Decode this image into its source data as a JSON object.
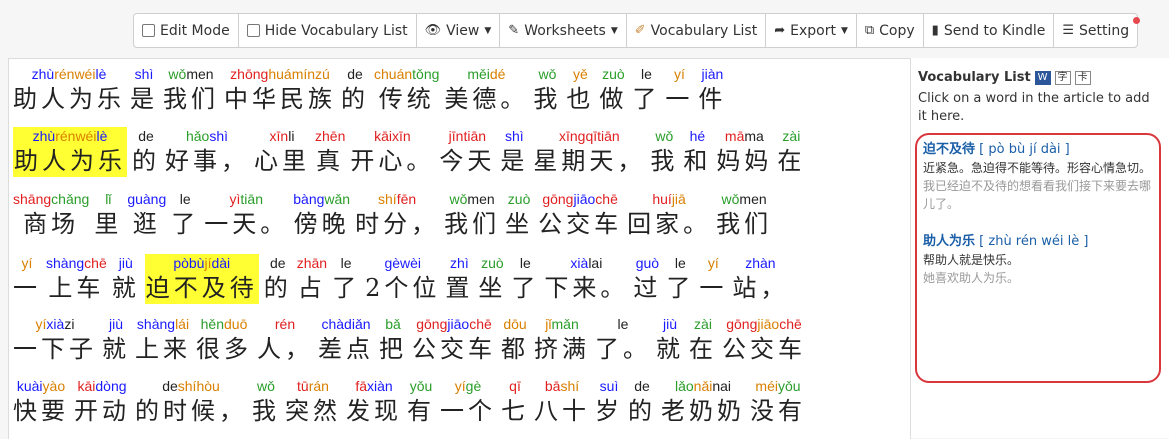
{
  "toolbar": {
    "edit_mode": "Edit Mode",
    "hide_vocab": "Hide Vocabulary List",
    "view": "View",
    "worksheets": "Worksheets",
    "vocab_list": "Vocabulary List",
    "export": "Export",
    "copy": "Copy",
    "send_kindle": "Send to Kindle",
    "setting": "Setting"
  },
  "colors": {
    "blue": "#1a1aff",
    "green": "#2a9d2a",
    "red": "#e02020",
    "orange": "#d98000",
    "highlight": "#ffff33",
    "circle": "#d9373e"
  },
  "article": [
    [
      [
        "zhù",
        "b",
        "rén",
        "o",
        "wéi",
        "o",
        "lè",
        "b",
        "助人为乐"
      ],
      [
        "shì",
        "b",
        "是"
      ],
      [
        "wǒ",
        "g",
        "men",
        "k",
        "我们"
      ],
      [
        "zhōng",
        "r",
        "huá",
        "o",
        "mín",
        "o",
        "zú",
        "o",
        "中华民族"
      ],
      [
        "de",
        "k",
        "的"
      ],
      [
        "chuán",
        "o",
        "tǒng",
        "g",
        "传统"
      ],
      [
        "měi",
        "g",
        "dé",
        "o",
        "美德。"
      ],
      [
        "wǒ",
        "g",
        "我"
      ],
      [
        "yě",
        "o",
        "也"
      ],
      [
        "zuò",
        "g",
        "做"
      ],
      [
        "le",
        "k",
        "了"
      ],
      [
        "yí",
        "o",
        "一"
      ],
      [
        "jiàn",
        "b",
        "件"
      ]
    ],
    [
      [
        "zhù",
        "b",
        "rén",
        "o",
        "wéi",
        "o",
        "lè",
        "b",
        "助人为乐",
        "hl"
      ],
      [
        "de",
        "k",
        "的"
      ],
      [
        "hǎo",
        "g",
        "shì",
        "b",
        "好事，"
      ],
      [
        "xīn",
        "r",
        "li",
        "k",
        "心里"
      ],
      [
        "zhēn",
        "r",
        "真"
      ],
      [
        "kāi",
        "r",
        "xīn",
        "r",
        "开心。"
      ],
      [
        "jīn",
        "r",
        "tiān",
        "r",
        "今天"
      ],
      [
        "shì",
        "b",
        "是"
      ],
      [
        "xīng",
        "r",
        "qī",
        "r",
        "tiān",
        "r",
        "星期天，"
      ],
      [
        "wǒ",
        "g",
        "我"
      ],
      [
        "hé",
        "b",
        "和"
      ],
      [
        "mā",
        "r",
        "ma",
        "k",
        "妈妈"
      ],
      [
        "zài",
        "g",
        "在"
      ]
    ],
    [
      [
        "shāng",
        "r",
        "chǎng",
        "g",
        "商场"
      ],
      [
        "lǐ",
        "g",
        "里"
      ],
      [
        "guàng",
        "b",
        "逛"
      ],
      [
        "le",
        "k",
        "了"
      ],
      [
        "yì",
        "r",
        "tiān",
        "g",
        "一天。"
      ],
      [
        "bàng",
        "b",
        "wǎn",
        "g",
        "傍晚"
      ],
      [
        "shí",
        "o",
        "fēn",
        "r",
        "时分，"
      ],
      [
        "wǒ",
        "g",
        "men",
        "k",
        "我们"
      ],
      [
        "zuò",
        "g",
        "坐"
      ],
      [
        "gōng",
        "r",
        "jiāo",
        "b",
        "chē",
        "r",
        "公交车"
      ],
      [
        "huí",
        "r",
        "jiā",
        "o",
        "回家。"
      ],
      [
        "wǒ",
        "g",
        "men",
        "k",
        "我们"
      ]
    ],
    [
      [
        "yí",
        "o",
        "一"
      ],
      [
        "shàng",
        "b",
        "chē",
        "r",
        "上车"
      ],
      [
        "jiù",
        "b",
        "就"
      ],
      [
        "pò",
        "b",
        "bù",
        "b",
        "jí",
        "o",
        "dài",
        "b",
        "迫不及待",
        "hl"
      ],
      [
        "de",
        "k",
        "的"
      ],
      [
        "zhān",
        "r",
        "占"
      ],
      [
        "le",
        "k",
        "了"
      ],
      [
        "gè",
        "b",
        "wèi",
        "b",
        "2个位"
      ],
      [
        "zhì",
        "b",
        "置"
      ],
      [
        "zuò",
        "g",
        "坐"
      ],
      [
        "le",
        "k",
        "了"
      ],
      [
        "xià",
        "b",
        "lai",
        "k",
        "下来。"
      ],
      [
        "guò",
        "b",
        "过"
      ],
      [
        "le",
        "k",
        "了"
      ],
      [
        "yí",
        "o",
        "一"
      ],
      [
        "zhàn",
        "b",
        "站，"
      ]
    ],
    [
      [
        "yí",
        "o",
        "xià",
        "b",
        "zi",
        "k",
        "一下子"
      ],
      [
        "jiù",
        "b",
        "就"
      ],
      [
        "shàng",
        "b",
        "lái",
        "o",
        "上来"
      ],
      [
        "hěn",
        "g",
        "duō",
        "o",
        "很多"
      ],
      [
        "rén",
        "r",
        "人，"
      ],
      [
        "chà",
        "b",
        "diǎn",
        "b",
        "差点"
      ],
      [
        "bǎ",
        "g",
        "把"
      ],
      [
        "gōng",
        "r",
        "jiāo",
        "b",
        "chē",
        "r",
        "公交车"
      ],
      [
        "dōu",
        "o",
        "都"
      ],
      [
        "jǐ",
        "o",
        "mǎn",
        "g",
        "挤满"
      ],
      [
        "le",
        "k",
        "了。"
      ],
      [
        "jiù",
        "b",
        "就"
      ],
      [
        "zài",
        "g",
        "在"
      ],
      [
        "gōng",
        "r",
        "jiāo",
        "o",
        "chē",
        "r",
        "公交车"
      ]
    ],
    [
      [
        "kuài",
        "b",
        "yào",
        "o",
        "快要"
      ],
      [
        "kāi",
        "r",
        "dòng",
        "b",
        "开动"
      ],
      [
        "de",
        "k",
        "shí",
        "o",
        "hòu",
        "o",
        "的时候，"
      ],
      [
        "wǒ",
        "g",
        "我"
      ],
      [
        "tū",
        "r",
        "rán",
        "o",
        "突然"
      ],
      [
        "fā",
        "r",
        "xiàn",
        "b",
        "发现"
      ],
      [
        "yǒu",
        "g",
        "有"
      ],
      [
        "yí",
        "o",
        "gè",
        "g",
        "一个"
      ],
      [
        "qī",
        "r",
        "七"
      ],
      [
        "bā",
        "r",
        "shí",
        "o",
        "八十"
      ],
      [
        "suì",
        "b",
        "岁"
      ],
      [
        "de",
        "k",
        "的"
      ],
      [
        "lǎo",
        "g",
        "nǎi",
        "o",
        "nai",
        "k",
        "老奶奶"
      ],
      [
        "méi",
        "o",
        "yǒu",
        "g",
        "没有"
      ]
    ]
  ],
  "sidebar": {
    "title": "Vocabulary List",
    "icon_w": "W",
    "icon_zi": "字",
    "icon_ka": "卡",
    "hint": "Click on a word in the article to add it here.",
    "entries": [
      {
        "word": "迫不及待",
        "pinyin_open": "[",
        "pinyin": "pò bù jí dài",
        "pinyin_close": "]",
        "definition": "近紧急。急迫得不能等待。形容心情急切。",
        "example": "我已经迫不及待的想看看我们接下来要去哪儿了。"
      },
      {
        "word": "助人为乐",
        "pinyin_open": "[",
        "pinyin": "zhù rén wéi lè",
        "pinyin_close": "]",
        "definition": "帮助人就是快乐。",
        "example": "她喜欢助人为乐。"
      }
    ]
  }
}
